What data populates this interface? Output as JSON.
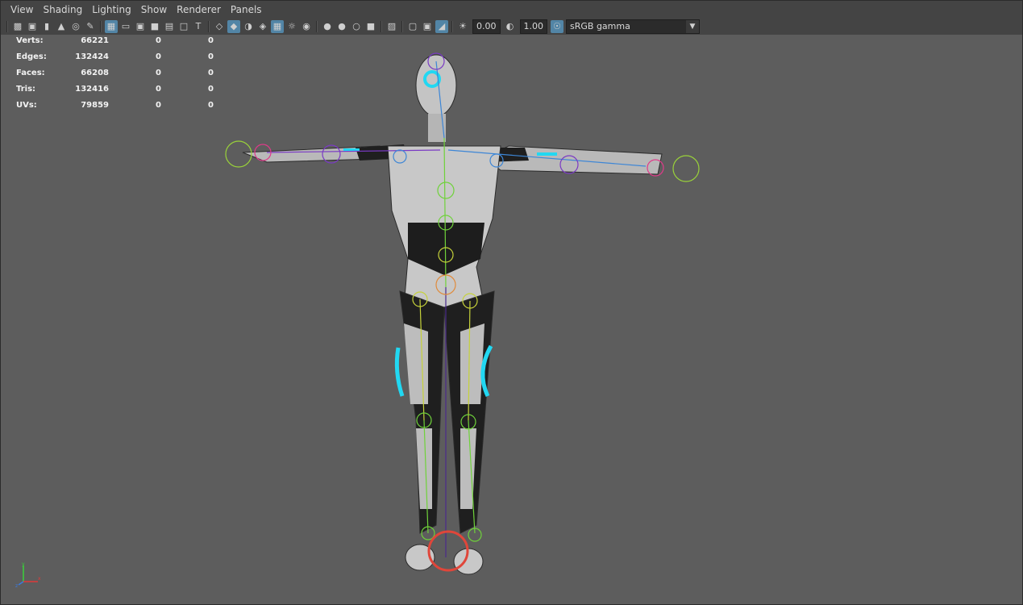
{
  "menu": [
    "View",
    "Shading",
    "Lighting",
    "Show",
    "Renderer",
    "Panels"
  ],
  "toolbar": {
    "exposure_value": "0.00",
    "gamma_value": "1.00",
    "color_space": "sRGB gamma"
  },
  "hud": {
    "rows": [
      {
        "label": "Verts:",
        "value": "66221",
        "c2": "0",
        "c3": "0"
      },
      {
        "label": "Edges:",
        "value": "132424",
        "c2": "0",
        "c3": "0"
      },
      {
        "label": "Faces:",
        "value": "66208",
        "c2": "0",
        "c3": "0"
      },
      {
        "label": "Tris:",
        "value": "132416",
        "c2": "0",
        "c3": "0"
      },
      {
        "label": "UVs:",
        "value": "79859",
        "c2": "0",
        "c3": "0"
      }
    ]
  },
  "axis": {
    "x": "x",
    "y": "y",
    "z": "z"
  },
  "colors": {
    "viewport_bg": "#5d5d5d",
    "panel_bg": "#444444",
    "active_icon": "#5285a6",
    "skeleton_green": "#6fd23a",
    "skeleton_blue": "#3d86d6",
    "glow_cyan": "#21d8f2",
    "selection_red": "#e0463a"
  }
}
